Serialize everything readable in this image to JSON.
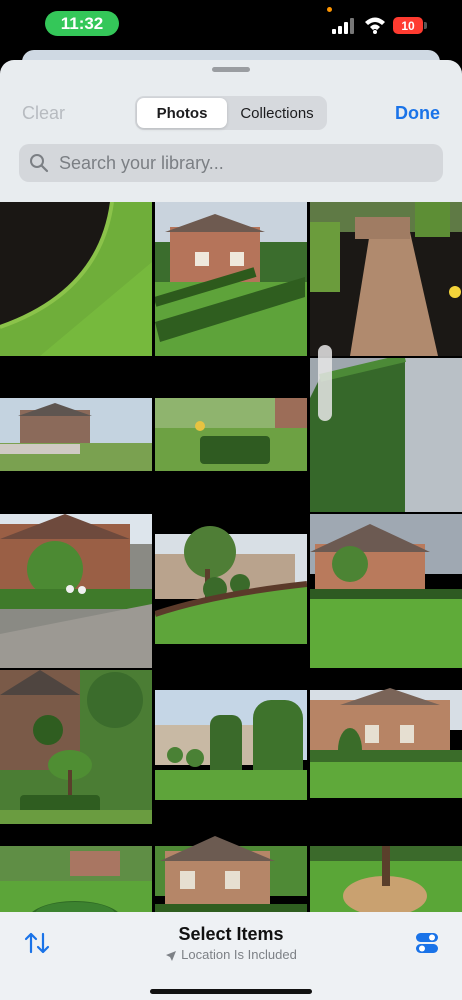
{
  "status_bar": {
    "time": "11:32",
    "battery": "10"
  },
  "header": {
    "clear_label": "Clear",
    "tabs": [
      {
        "label": "Photos",
        "selected": true
      },
      {
        "label": "Collections",
        "selected": false
      }
    ],
    "done_label": "Done"
  },
  "search": {
    "placeholder": "Search your library..."
  },
  "photos": {
    "columns": 3,
    "items": [
      "mulch-edge",
      "brick-house-hedge",
      "brick-walkway",
      "neighborhood-street",
      "hedge-trimming",
      "hedge-sidewalk",
      "house-garden-patio",
      "lawn-shrubs",
      "brick-house-lawn",
      "house-topiary",
      "tall-topiary",
      "brick-house-bushes",
      "round-hedge",
      "brick-house-yard",
      "tree-mulch-ring"
    ]
  },
  "bottom_bar": {
    "title": "Select Items",
    "subtitle": "Location Is Included"
  },
  "colors": {
    "accent": "#1a73e8",
    "status_green": "#34c759",
    "battery_red": "#ff3b30"
  }
}
